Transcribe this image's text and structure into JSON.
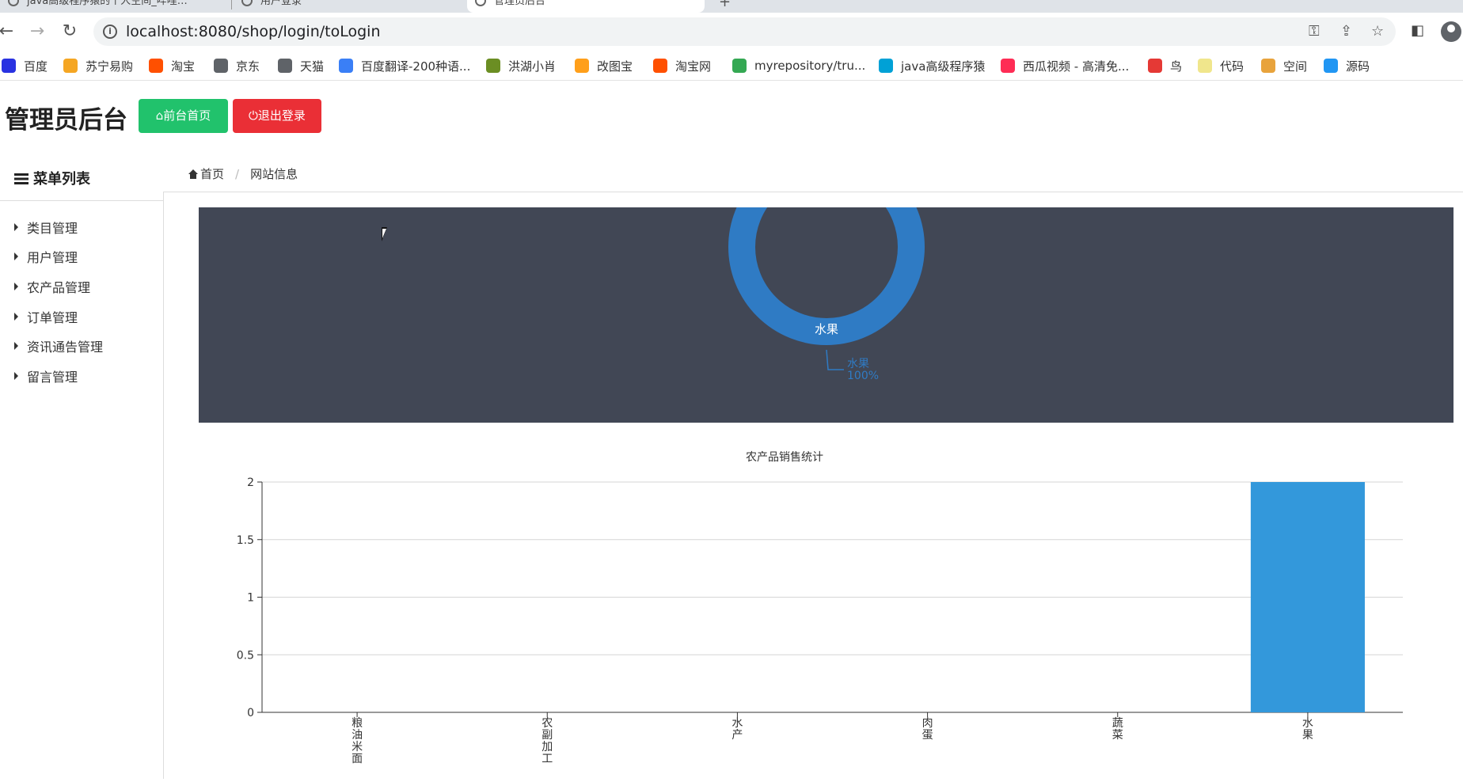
{
  "browser": {
    "tabs": [
      {
        "label": "java高级程序猿的个人空间_哔哩…"
      },
      {
        "label": "用户登录"
      },
      {
        "label": "管理员后台"
      }
    ],
    "url": "localhost:8080/shop/login/toLogin",
    "bookmarks": [
      {
        "label": "百度",
        "icon": "baidu-paw-icon",
        "color": "#2932e1"
      },
      {
        "label": "苏宁易购",
        "icon": "suning-icon",
        "color": "#f5a623"
      },
      {
        "label": "淘宝",
        "icon": "taobao-icon",
        "color": "#ff5000"
      },
      {
        "label": "京东",
        "icon": "globe-icon",
        "color": "#5f6368"
      },
      {
        "label": "天猫",
        "icon": "globe-icon",
        "color": "#5f6368"
      },
      {
        "label": "百度翻译-200种语...",
        "icon": "translate-icon",
        "color": "#3a7ff6"
      },
      {
        "label": "洪湖小肖",
        "icon": "bird-icon",
        "color": "#6b8e23"
      },
      {
        "label": "改图宝",
        "icon": "gaitubao-icon",
        "color": "#ff9f1a"
      },
      {
        "label": "淘宝网",
        "icon": "taobao-icon",
        "color": "#ff5000"
      },
      {
        "label": "myrepository/tru...",
        "icon": "chrome-icon",
        "color": "#34a853"
      },
      {
        "label": "java高级程序猿",
        "icon": "bilibili-icon",
        "color": "#00a1d6"
      },
      {
        "label": "西瓜视频 - 高清免...",
        "icon": "xigua-icon",
        "color": "#fe2c55"
      },
      {
        "label": "鸟",
        "icon": "bird-red-icon",
        "color": "#e53935"
      },
      {
        "label": "代码",
        "icon": "code-icon",
        "color": "#f0e68c"
      },
      {
        "label": "空间",
        "icon": "qzone-icon",
        "color": "#e8a33c"
      },
      {
        "label": "源码",
        "icon": "source-fish-icon",
        "color": "#2196f3"
      }
    ]
  },
  "header": {
    "title": "管理员后台",
    "home_button": "前台首页",
    "logout_button": "退出登录"
  },
  "sidebar": {
    "title": "菜单列表",
    "items": [
      {
        "label": "类目管理"
      },
      {
        "label": "用户管理"
      },
      {
        "label": "农产品管理"
      },
      {
        "label": "订单管理"
      },
      {
        "label": "资讯通告管理"
      },
      {
        "label": "留言管理"
      }
    ]
  },
  "breadcrumb": {
    "home": "首页",
    "current": "网站信息"
  },
  "chart_data": [
    {
      "type": "pie",
      "style": "donut",
      "background": "#414755",
      "slices": [
        {
          "name": "水果",
          "value": 100,
          "percent": "100%",
          "color": "#2f7bc4"
        }
      ],
      "inner_label": "水果",
      "callout_label": "水果",
      "callout_percent": "100%"
    },
    {
      "type": "bar",
      "title": "农产品销售统计",
      "categories": [
        "粮油米面",
        "农副加工",
        "水产",
        "肉蛋",
        "蔬菜",
        "水果"
      ],
      "values": [
        0,
        0,
        0,
        0,
        0,
        2
      ],
      "ylim": [
        0,
        2
      ],
      "yticks": [
        "0",
        "0.5",
        "1",
        "1.5",
        "2"
      ],
      "grid": true,
      "bar_color": "#3398db"
    }
  ]
}
